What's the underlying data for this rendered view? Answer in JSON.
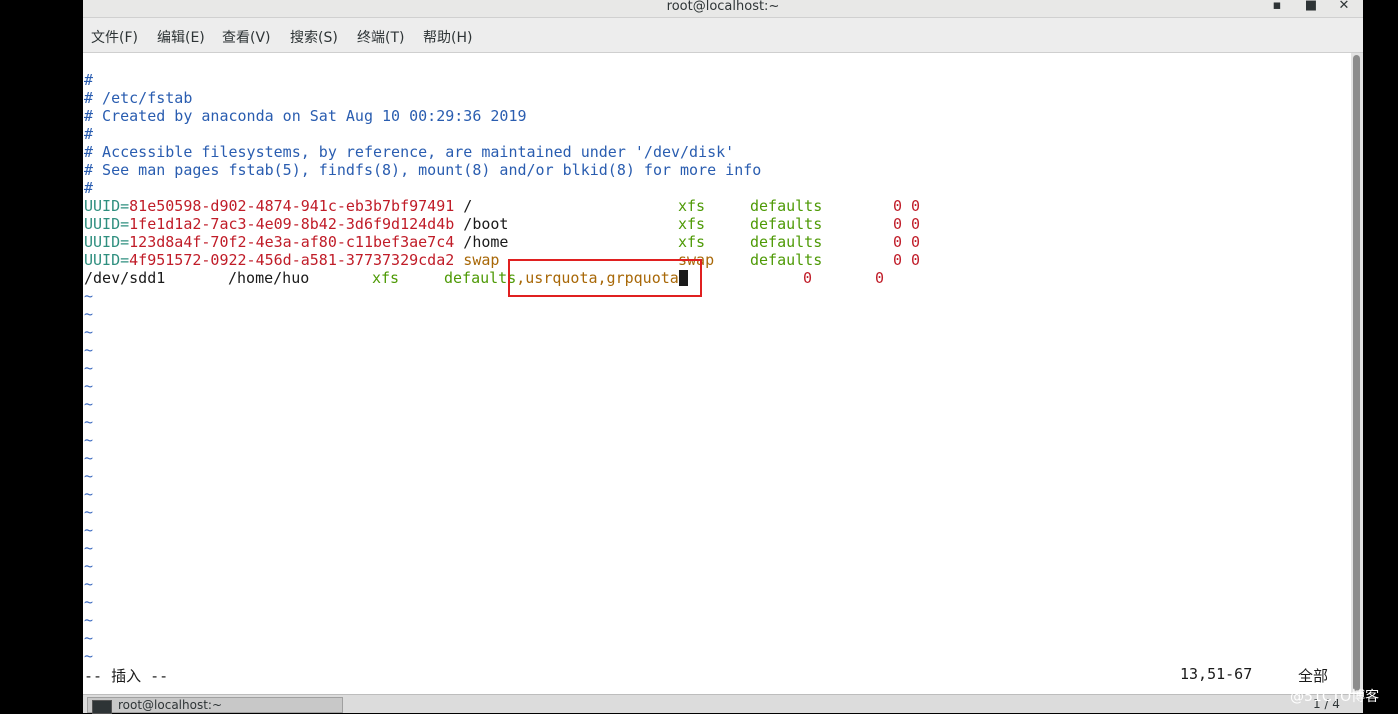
{
  "window": {
    "title": "root@localhost:~",
    "minimize_glyph": "▪",
    "maximize_glyph": "■",
    "close_glyph": "✕"
  },
  "menubar": {
    "items": [
      "文件(F)",
      "编辑(E)",
      "查看(V)",
      "搜索(S)",
      "终端(T)",
      "帮助(H)"
    ]
  },
  "file": {
    "comment_lines": [
      "#",
      "# /etc/fstab",
      "# Created by anaconda on Sat Aug 10 00:29:36 2019",
      "#",
      "# Accessible filesystems, by reference, are maintained under '/dev/disk'",
      "# See man pages fstab(5), findfs(8), mount(8) and/or blkid(8) for more info",
      "#"
    ],
    "entries": [
      {
        "key": "UUID",
        "eq": "=",
        "uuid": "81e50598-d902-4874-941c-eb3b7bf97491",
        "mount": "/",
        "fstype": "xfs",
        "options": "defaults",
        "dump": "0",
        "pass": "0"
      },
      {
        "key": "UUID",
        "eq": "=",
        "uuid": "1fe1d1a2-7ac3-4e09-8b42-3d6f9d124d4b",
        "mount": "/boot",
        "fstype": "xfs",
        "options": "defaults",
        "dump": "0",
        "pass": "0"
      },
      {
        "key": "UUID",
        "eq": "=",
        "uuid": "123d8a4f-70f2-4e3a-af80-c11bef3ae7c4",
        "mount": "/home",
        "fstype": "xfs",
        "options": "defaults",
        "dump": "0",
        "pass": "0"
      },
      {
        "key": "UUID",
        "eq": "=",
        "uuid": "4f951572-0922-456d-a581-37737329cda2",
        "mount": "swap",
        "fstype": "swap",
        "options": "defaults",
        "dump": "0",
        "pass": "0"
      }
    ],
    "edited_line": {
      "device": "/dev/sdd1",
      "mount": "/home/huo",
      "fstype": "xfs",
      "options_base": "defaults",
      "options_added": ",usrquota,grpquota",
      "dump": "0",
      "pass": "0"
    },
    "tilde": "~"
  },
  "statusline": {
    "mode": "-- 插入 --",
    "position": "13,51-67",
    "scroll": "全部"
  },
  "taskbar": {
    "task_label": "root@localhost:~",
    "pager": "1 / 4"
  },
  "watermark": "@51CTO博客"
}
